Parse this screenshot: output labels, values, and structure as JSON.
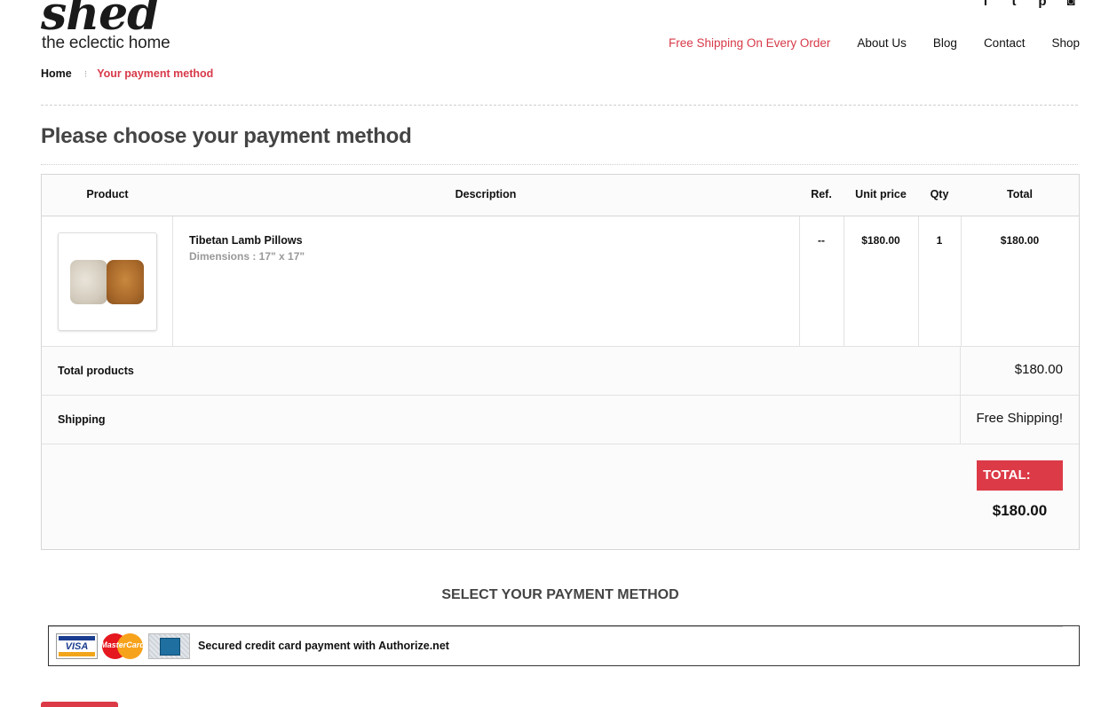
{
  "brand": {
    "logo_word": "shed",
    "tagline": "the eclectic home"
  },
  "social": [
    {
      "name": "facebook-icon",
      "glyph": "f"
    },
    {
      "name": "twitter-icon",
      "glyph": "t"
    },
    {
      "name": "pinterest-icon",
      "glyph": "p"
    },
    {
      "name": "instagram-icon",
      "glyph": "◙"
    }
  ],
  "nav": {
    "promo": "Free Shipping On Every Order",
    "about": "About Us",
    "blog": "Blog",
    "contact": "Contact",
    "shop": "Shop"
  },
  "breadcrumb": {
    "home": "Home",
    "separator": "⁝",
    "current": "Your payment method"
  },
  "page_title": "Please choose your payment method",
  "table": {
    "headers": {
      "product": "Product",
      "description": "Description",
      "ref": "Ref.",
      "unit_price": "Unit price",
      "qty": "Qty",
      "total": "Total"
    },
    "item": {
      "name": "Tibetan Lamb Pillows",
      "dimensions": "Dimensions : 17\" x 17\"",
      "ref": "--",
      "unit_price": "$180.00",
      "qty": "1",
      "total": "$180.00"
    },
    "summary": {
      "total_products_label": "Total products",
      "total_products_value": "$180.00",
      "shipping_label": "Shipping",
      "shipping_value": "Free Shipping!",
      "grand_total_label": "TOTAL:",
      "grand_total_value": "$180.00"
    }
  },
  "payment": {
    "title": "SELECT YOUR PAYMENT METHOD",
    "option_label": "Secured credit card payment with Authorize.net",
    "cards": {
      "visa": "VISA",
      "mastercard": "MasterCard"
    }
  },
  "colors": {
    "accent": "#dc3a47",
    "link_red": "#d73a49",
    "heading_gray": "#444444"
  }
}
